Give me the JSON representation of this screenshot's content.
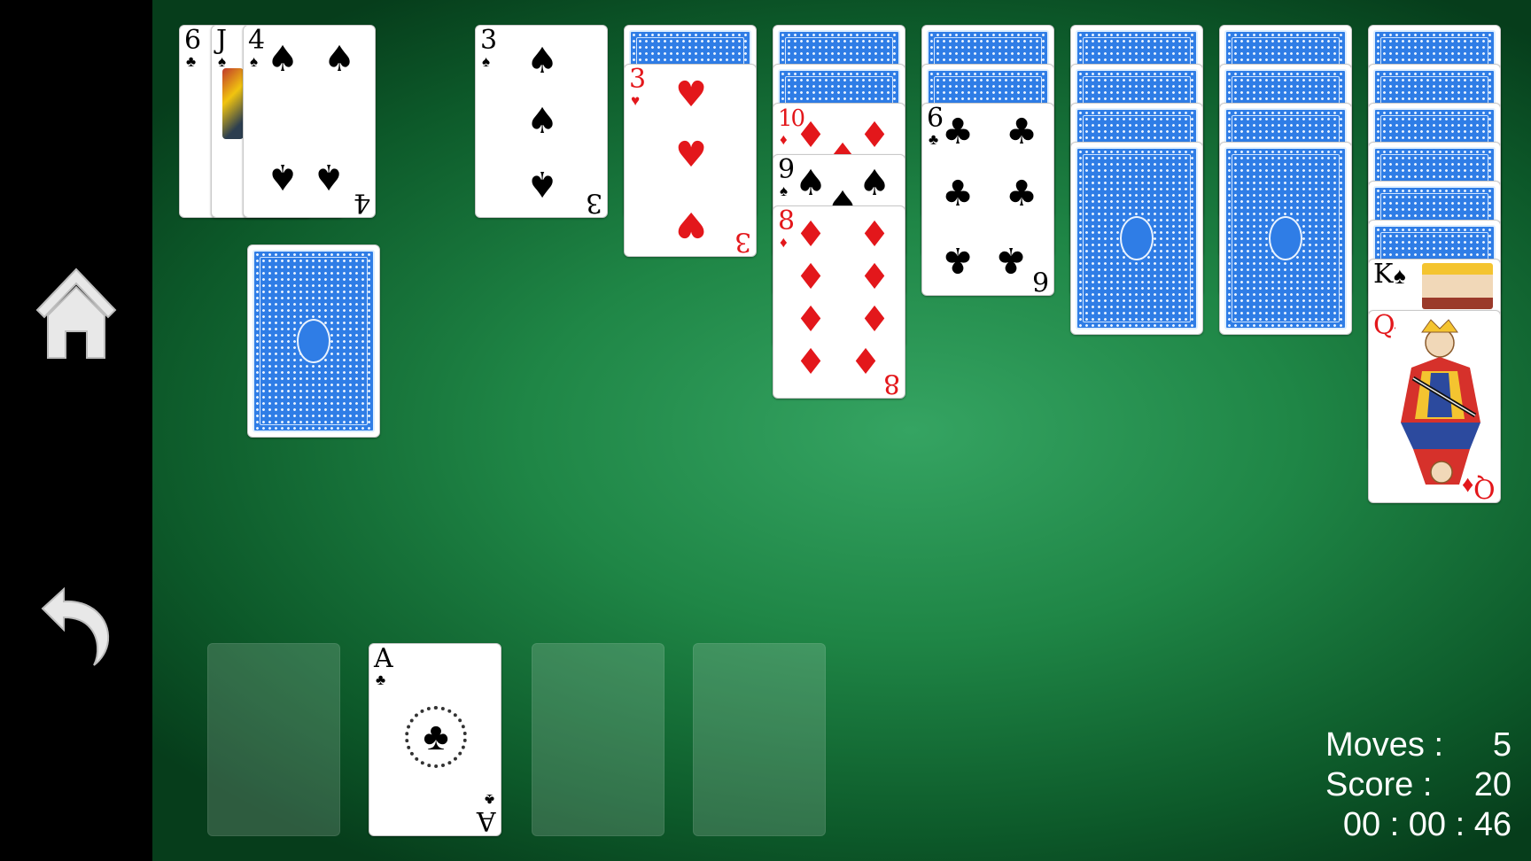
{
  "sidebar": {
    "home_icon": "home-icon",
    "undo_icon": "undo-icon"
  },
  "waste": {
    "fanned": [
      {
        "rank": "6",
        "suit": "♣",
        "color": "black"
      },
      {
        "rank": "J",
        "suit": "♠",
        "color": "black"
      },
      {
        "rank": "4",
        "suit": "♠",
        "color": "black"
      }
    ]
  },
  "foundations": [
    {
      "rank": "",
      "suit": ""
    },
    {
      "rank": "A",
      "suit": "♣",
      "color": "black"
    },
    {
      "rank": "",
      "suit": ""
    },
    {
      "rank": "",
      "suit": ""
    }
  ],
  "tableau": [
    {
      "face_down": 0,
      "face_up": [
        {
          "rank": "3",
          "suit": "♠",
          "color": "black"
        }
      ]
    },
    {
      "face_down": 1,
      "face_up": [
        {
          "rank": "3",
          "suit": "♥",
          "color": "red"
        }
      ]
    },
    {
      "face_down": 2,
      "face_up": [
        {
          "rank": "10",
          "suit": "♦",
          "color": "red"
        },
        {
          "rank": "9",
          "suit": "♠",
          "color": "black"
        },
        {
          "rank": "8",
          "suit": "♦",
          "color": "red"
        }
      ]
    },
    {
      "face_down": 2,
      "face_up": [
        {
          "rank": "6",
          "suit": "♣",
          "color": "black"
        }
      ]
    },
    {
      "face_down": 4,
      "face_up": []
    },
    {
      "face_down": 4,
      "face_up": []
    },
    {
      "face_down": 6,
      "face_up": [
        {
          "rank": "K",
          "suit": "♠",
          "color": "black"
        },
        {
          "rank": "Q",
          "suit": "♦",
          "color": "red"
        }
      ]
    }
  ],
  "stats": {
    "moves_label": "Moves :",
    "moves": "5",
    "score_label": "Score :",
    "score": "20",
    "timer": "00 : 00 : 46"
  },
  "colors": {
    "felt": "#1f8646",
    "card_back": "#2f7de6",
    "red_suit": "#e3171b"
  }
}
